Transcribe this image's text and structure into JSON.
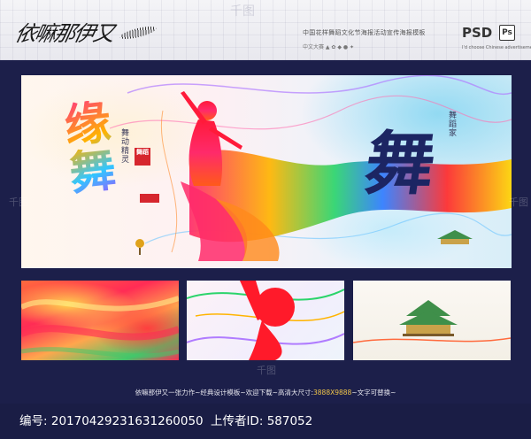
{
  "header": {
    "signature": "依嘛那伊又",
    "tagline": "中国花样舞蹈文化节海报活动宣传海报模板",
    "sub_tagline": "中文大赛  ▲  ✿  ◆  ●  ✦",
    "format_label": "PSD",
    "ps_badge": "Ps",
    "format_sub": "I'd choose Chinese advertisement",
    "watermark": "千图"
  },
  "poster": {
    "char_left": "缘舞",
    "char_right": "舞",
    "red_tag_text": "舞蹈",
    "small_vertical_left": "舞动精灵",
    "small_vertical_right": "舞蹈家"
  },
  "thumbnails": [
    {
      "label": "colorful-fabric-detail"
    },
    {
      "label": "red-silhouette-detail"
    },
    {
      "label": "temple-building-detail"
    }
  ],
  "footer": {
    "credit_pre": "依嘛那伊又一张力作~经典设计模板~欢迎下载~高清大尺寸:",
    "credit_size": "3888X9888",
    "credit_post": "~文字可替换~",
    "id_label": "编号:",
    "id_value": "20170429231631260050",
    "uploader_label": "上传者ID:",
    "uploader_value": "587052"
  },
  "colors": {
    "background": "#1c1f4a",
    "accent_red": "#d6262e",
    "text_gold": "#f0c64a"
  }
}
